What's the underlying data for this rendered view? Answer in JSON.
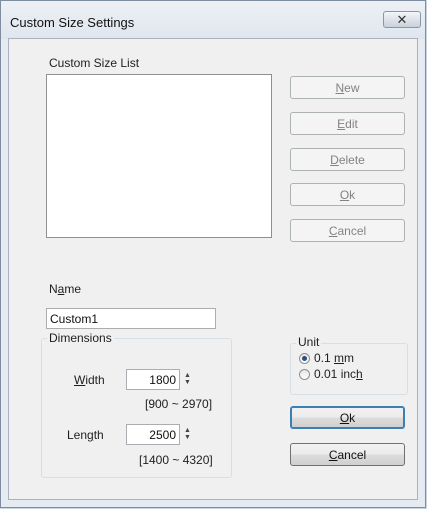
{
  "window": {
    "title": "Custom Size Settings",
    "close_glyph": "✕"
  },
  "list": {
    "label": "Custom Size List",
    "items": []
  },
  "side_buttons": [
    {
      "pre": "",
      "key": "N",
      "post": "ew",
      "enabled": false
    },
    {
      "pre": "",
      "key": "E",
      "post": "dit",
      "enabled": false
    },
    {
      "pre": "",
      "key": "D",
      "post": "elete",
      "enabled": false
    },
    {
      "pre": "",
      "key": "O",
      "post": "k",
      "enabled": false
    },
    {
      "pre": "",
      "key": "C",
      "post": "ancel",
      "enabled": false
    }
  ],
  "name": {
    "label_pre": "N",
    "label_key": "a",
    "label_post": "me",
    "value": "Custom1"
  },
  "dimensions": {
    "label": "Dimensions",
    "width": {
      "label_pre": "",
      "label_key": "W",
      "label_post": "idth",
      "value": "1800",
      "range": "[900 ~ 2970]"
    },
    "length": {
      "label_pre": "Len",
      "label_key": "g",
      "label_post": "th",
      "value": "2500",
      "range": "[1400 ~ 4320]"
    }
  },
  "unit": {
    "label": "Unit",
    "options": [
      {
        "pre": "0.1 ",
        "key": "m",
        "post": "m",
        "checked": true
      },
      {
        "pre": "0.01 inc",
        "key": "h",
        "post": "",
        "checked": false
      }
    ]
  },
  "footer_buttons": [
    {
      "pre": "",
      "key": "O",
      "post": "k",
      "focused": true
    },
    {
      "pre": "",
      "key": "C",
      "post": "ancel",
      "focused": false
    }
  ],
  "icons": {
    "close": "close-icon",
    "spin_up": "▲",
    "spin_down": "▼"
  }
}
